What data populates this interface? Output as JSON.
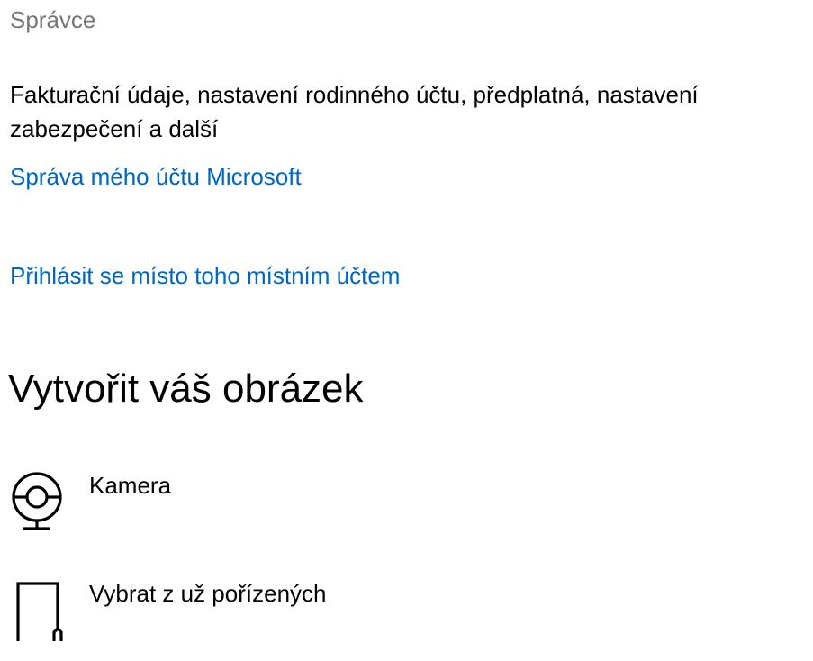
{
  "account": {
    "role": "Správce",
    "description": "Fakturační údaje, nastavení rodinného účtu, předplatná, nastavení zabezpečení a další",
    "manage_link": "Správa mého účtu Microsoft",
    "local_account_link": "Přihlásit se místo toho místním účtem"
  },
  "picture_section": {
    "title": "Vytvořit váš obrázek",
    "options": [
      {
        "label": "Kamera",
        "icon": "camera-icon"
      },
      {
        "label": "Vybrat z už pořízených",
        "icon": "browse-file-icon"
      }
    ]
  },
  "colors": {
    "link": "#0067c0",
    "secondary_text": "#767676",
    "text": "#000000",
    "background": "#ffffff"
  }
}
